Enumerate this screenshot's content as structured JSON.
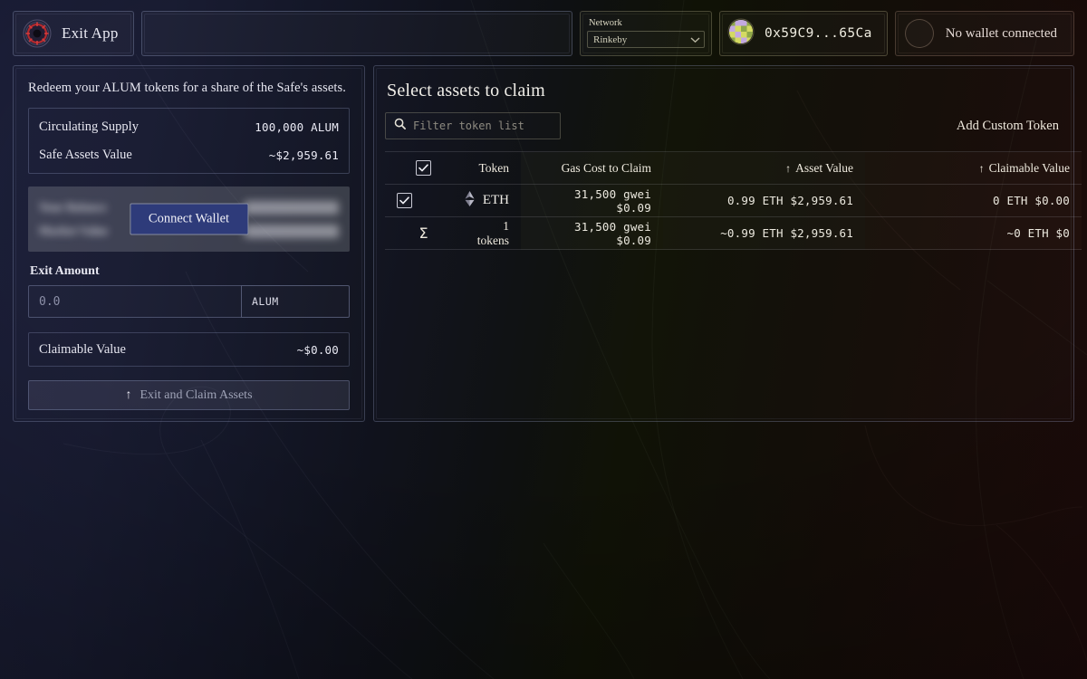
{
  "header": {
    "exit_app_label": "Exit App",
    "logo_icon": "exit-app-logo-icon",
    "network": {
      "label": "Network",
      "value": "Rinkeby",
      "chevron_icon": "chevron-down-icon"
    },
    "wallet_address": "0x59C9...65Ca",
    "wallet_avatar_icon": "blockie-avatar-icon",
    "wallet_status": "No wallet connected"
  },
  "left_panel": {
    "description": "Redeem your ALUM tokens for a share of the Safe's assets.",
    "stats": [
      {
        "label": "Circulating Supply",
        "value": "100,000 ALUM"
      },
      {
        "label": "Safe Assets Value",
        "value": "~$2,959.61"
      }
    ],
    "balance_card": {
      "hidden_rows": [
        {
          "label": "Your Balance"
        },
        {
          "label": "Market Value"
        }
      ],
      "connect_wallet_label": "Connect Wallet"
    },
    "exit_amount": {
      "label": "Exit Amount",
      "placeholder": "0.0",
      "value": "0.0",
      "unit": "ALUM"
    },
    "claimable": {
      "label": "Claimable Value",
      "value": "~$0.00"
    },
    "exit_button": {
      "label": "Exit and Claim Assets",
      "icon": "arrow-up-icon"
    }
  },
  "right_panel": {
    "title": "Select assets to claim",
    "filter": {
      "placeholder": "Filter token list",
      "value": "",
      "icon": "search-icon"
    },
    "add_custom_token_label": "Add Custom Token",
    "table": {
      "headers": {
        "select_all_icon": "checkbox-checked-icon",
        "token": "Token",
        "gas": "Gas Cost to Claim",
        "asset_value": "Asset Value",
        "claimable_value": "Claimable Value",
        "sort_arrow": "↑"
      },
      "rows": [
        {
          "checked": true,
          "checkbox_icon": "checkbox-checked-icon",
          "token_icon": "ethereum-icon",
          "token": "ETH",
          "gas": "31,500 gwei $0.09",
          "asset_value": "0.99 ETH $2,959.61",
          "claimable_value": "0 ETH $0.00"
        }
      ],
      "summary": {
        "sigma_icon": "sigma-icon",
        "sigma": "Σ",
        "token_count": "1 tokens",
        "gas": "31,500 gwei $0.09",
        "asset_value": "~0.99 ETH $2,959.61",
        "claimable_value": "~0 ETH $0"
      }
    }
  },
  "colors": {
    "accent_button": "#2e3b7a",
    "bg_left": "#1b1e38",
    "bg_right": "#1c0b0a",
    "text_primary": "#efeade"
  }
}
